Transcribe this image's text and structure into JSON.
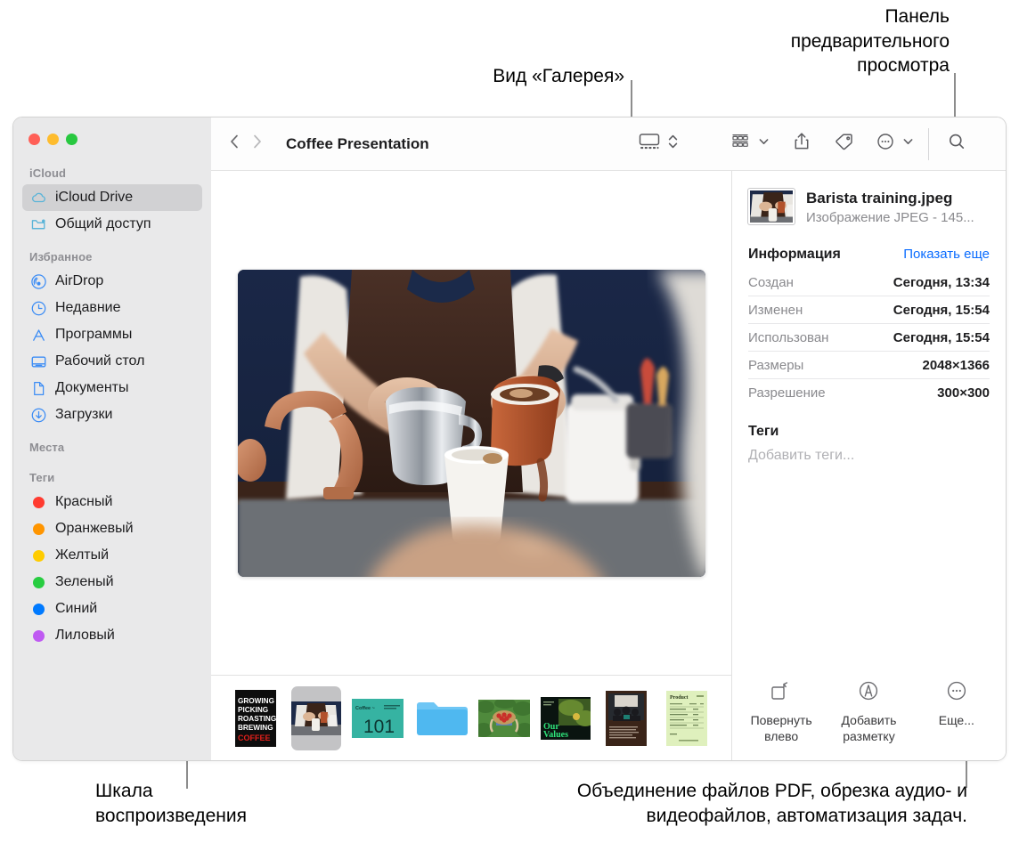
{
  "callouts": {
    "gallery_view": "Вид «Галерея»",
    "preview_panel": "Панель\nпредварительного\nпросмотра",
    "playback_scale": "Шкала\nвоспроизведения",
    "quick_actions": "Объединение файлов PDF, обрезка аудио- и\nвидеофайлов, автоматизация задач."
  },
  "window": {
    "title": "Coffee Presentation"
  },
  "sidebar": {
    "sections": [
      {
        "header": "iCloud",
        "items": [
          {
            "label": "iCloud Drive",
            "icon": "cloud-icon",
            "selected": true
          },
          {
            "label": "Общий доступ",
            "icon": "shared-folder-icon",
            "selected": false
          }
        ]
      },
      {
        "header": "Избранное",
        "items": [
          {
            "label": "AirDrop",
            "icon": "airdrop-icon",
            "selected": false
          },
          {
            "label": "Недавние",
            "icon": "clock-icon",
            "selected": false
          },
          {
            "label": "Программы",
            "icon": "applications-icon",
            "selected": false
          },
          {
            "label": "Рабочий стол",
            "icon": "desktop-icon",
            "selected": false
          },
          {
            "label": "Документы",
            "icon": "document-icon",
            "selected": false
          },
          {
            "label": "Загрузки",
            "icon": "downloads-icon",
            "selected": false
          }
        ]
      },
      {
        "header": "Места",
        "items": []
      },
      {
        "header": "Теги",
        "items": [
          {
            "label": "Красный",
            "icon": "tag-dot",
            "color": "#ff3b30"
          },
          {
            "label": "Оранжевый",
            "icon": "tag-dot",
            "color": "#ff9500"
          },
          {
            "label": "Желтый",
            "icon": "tag-dot",
            "color": "#ffcc00"
          },
          {
            "label": "Зеленый",
            "icon": "tag-dot",
            "color": "#28cd41"
          },
          {
            "label": "Синий",
            "icon": "tag-dot",
            "color": "#007aff"
          },
          {
            "label": "Лиловый",
            "icon": "tag-dot",
            "color": "#bf5af2"
          }
        ]
      }
    ]
  },
  "toolbar": {
    "back_icon": "chevron-left-icon",
    "forward_icon": "chevron-right-icon",
    "view_icon": "gallery-view-icon",
    "view_stepper_icon": "chevron-updown-icon",
    "group_icon": "group-by-icon",
    "group_caret_icon": "chevron-down-icon",
    "share_icon": "share-icon",
    "tag_icon": "tag-icon",
    "more_icon": "ellipsis-circle-icon",
    "more_caret_icon": "chevron-down-icon",
    "search_icon": "search-icon"
  },
  "inspector": {
    "file_name": "Barista training.jpeg",
    "file_kind": "Изображение JPEG - 145...",
    "info_title": "Информация",
    "show_more": "Показать еще",
    "metadata": [
      {
        "key": "Создан",
        "value": "Сегодня, 13:34"
      },
      {
        "key": "Изменен",
        "value": "Сегодня, 15:54"
      },
      {
        "key": "Использован",
        "value": "Сегодня, 15:54"
      },
      {
        "key": "Размеры",
        "value": "2048×1366"
      },
      {
        "key": "Разрешение",
        "value": "300×300"
      }
    ],
    "tags_title": "Теги",
    "tags_placeholder": "Добавить теги...",
    "quick_actions": [
      {
        "label": "Повернуть\nвлево",
        "icon": "rotate-left-icon"
      },
      {
        "label": "Добавить\nразметку",
        "icon": "markup-icon"
      },
      {
        "label": "Еще...",
        "icon": "ellipsis-circle-icon"
      }
    ]
  },
  "filmstrip": {
    "items": [
      {
        "name": "growing-picking-roasting-brewing-coffee-poster",
        "selected": false
      },
      {
        "name": "barista-training-photo",
        "selected": true
      },
      {
        "name": "coffee-101-slide",
        "selected": false
      },
      {
        "name": "blue-folder",
        "selected": false
      },
      {
        "name": "coffee-cherries-basket-photo",
        "selected": false
      },
      {
        "name": "our-values-slide",
        "selected": false
      },
      {
        "name": "team-meeting-document",
        "selected": false
      },
      {
        "name": "green-invoice-document",
        "selected": false
      }
    ],
    "poster_lines": [
      "GROWING",
      "PICKING",
      "ROASTING",
      "BREWING",
      "COFFEE"
    ],
    "slide_101": {
      "title": "Coffee ~",
      "number": "101"
    },
    "our_values": {
      "line1": "Our",
      "line2": "Values"
    }
  },
  "colors": {
    "accent_blue": "#0a6cff",
    "sidebar_bg": "#e9e9ea",
    "selected_bg": "#d1d1d3"
  }
}
